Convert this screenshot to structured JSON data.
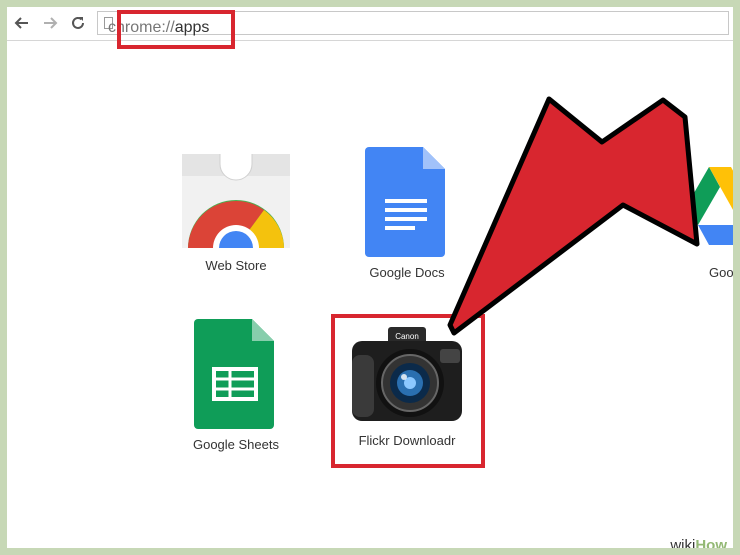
{
  "browser": {
    "url_scheme": "chrome://",
    "url_path": "apps"
  },
  "apps": {
    "webstore": {
      "label": "Web Store",
      "icon": "chrome-web-store-icon"
    },
    "docs": {
      "label": "Google Docs",
      "icon": "google-docs-icon"
    },
    "drive": {
      "label": "Goog",
      "icon": "google-drive-icon"
    },
    "sheets": {
      "label": "Google Sheets",
      "icon": "google-sheets-icon"
    },
    "flickr": {
      "label": "Flickr Downloadr",
      "icon": "camera-icon"
    }
  },
  "camera_brand": "Canon",
  "watermark": {
    "wiki": "wiki",
    "how": "How"
  },
  "colors": {
    "highlight_red": "#d8262f",
    "frame_green": "#c7d8b6",
    "docs_blue": "#4285f4",
    "sheets_green": "#0f9d58"
  }
}
